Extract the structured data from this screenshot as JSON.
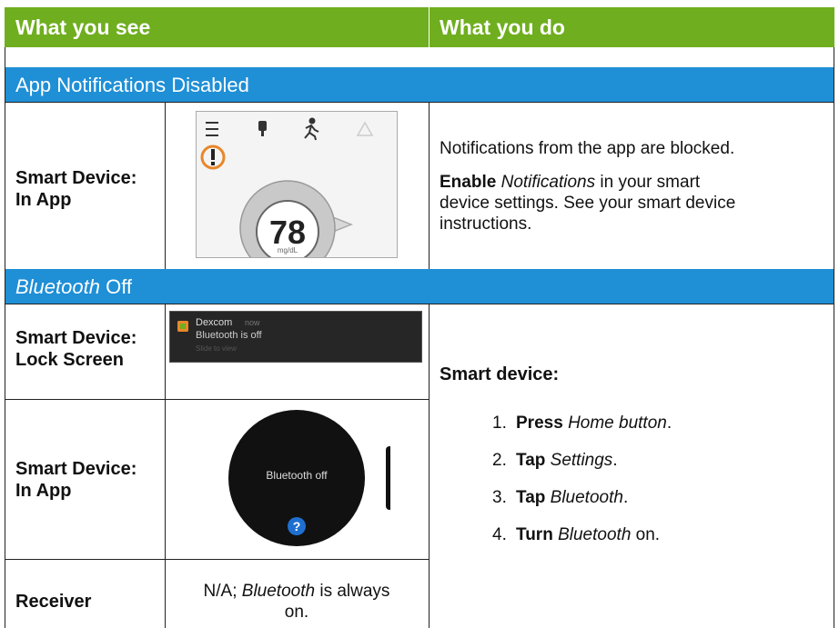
{
  "header": {
    "col_see": "What you see",
    "col_do": "What you do"
  },
  "section1": {
    "title": "App Notifications Disabled",
    "row_label_line1": "Smart Device:",
    "row_label_line2": "In App",
    "app_value": "78",
    "app_unit": "mg/dL",
    "action_line": "Notifications from the app are blocked.",
    "enable_word": "Enable",
    "notifications_word": "Notifications",
    "enable_rest_1": "in your smart",
    "enable_rest_2": "device settings. See your smart device",
    "enable_rest_3": "instructions."
  },
  "section2": {
    "title_italic": "Bluetooth",
    "title_rest": "Off",
    "lock_label_line1": "Smart Device:",
    "lock_label_line2": "Lock Screen",
    "lock_app_name": "Dexcom",
    "lock_app_time": "now",
    "lock_message": "Bluetooth is off",
    "lock_hint": "Slide to view",
    "inapp_label_line1": "Smart Device:",
    "inapp_label_line2": "In App",
    "watch_text": "Bluetooth off",
    "watch_help": "?",
    "receiver_label": "Receiver",
    "receiver_text_1": "N/A;",
    "receiver_text_italic": "Bluetooth",
    "receiver_text_2": "is always",
    "receiver_text_3": "on.",
    "smart_device_heading": "Smart device:",
    "steps": [
      {
        "num": "1.",
        "verb": "Press",
        "obj": "Home button",
        "tail": "."
      },
      {
        "num": "2.",
        "verb": "Tap",
        "obj": "Settings",
        "tail": "."
      },
      {
        "num": "3.",
        "verb": "Tap",
        "obj": "Bluetooth",
        "tail": "."
      },
      {
        "num": "4.",
        "verb": "Turn",
        "obj": "Bluetooth",
        "tail": " on."
      }
    ]
  },
  "colors": {
    "header_green": "#6fae1f",
    "section_blue": "#1f8fd6",
    "alert_orange": "#e8872a",
    "watch_bg": "#111111",
    "help_blue": "#1f6fd0"
  },
  "icons": [
    "menu-icon",
    "sensor-icon",
    "activity-icon",
    "alert-icon",
    "warning-icon",
    "help-icon",
    "dexcom-app-icon"
  ]
}
